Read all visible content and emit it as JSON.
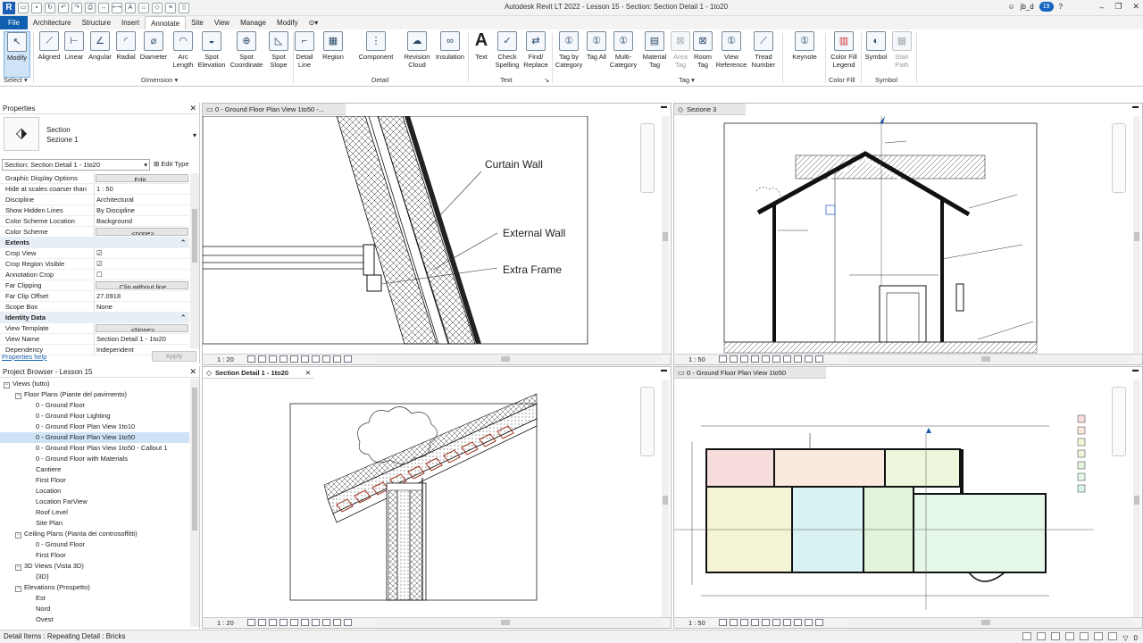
{
  "title_bar": {
    "app_title": "Autodesk Revit LT 2022 - Lesson 15 - Section: Section Detail 1 - 1to20",
    "user": "jb_d",
    "notification_count": "19"
  },
  "tabs": [
    "File",
    "Architecture",
    "Structure",
    "Insert",
    "Annotate",
    "Site",
    "View",
    "Manage",
    "Modify"
  ],
  "active_tab": "Annotate",
  "ribbon": {
    "select": {
      "modify": "Modify",
      "panel": "Select"
    },
    "dimension": {
      "aligned": "Aligned",
      "linear": "Linear",
      "angular": "Angular",
      "radial": "Radial",
      "diameter": "Diameter",
      "arc_length": "Arc Length",
      "spot_elevation": "Spot Elevation",
      "spot_coordinate": "Spot Coordinate",
      "spot_slope": "Spot Slope",
      "panel": "Dimension"
    },
    "detail": {
      "detail_line": "Detail Line",
      "region": "Region",
      "component": "Component",
      "revision_cloud": "Revision Cloud",
      "insulation": "Insulation",
      "panel": "Detail"
    },
    "text": {
      "text": "Text",
      "check_spelling": "Check Spelling",
      "find_replace": "Find/ Replace",
      "panel": "Text"
    },
    "tag": {
      "tag_by_category": "Tag by Category",
      "tag_all": "Tag All",
      "multi_category": "Multi- Category",
      "material_tag": "Material Tag",
      "area_tag": "Area Tag",
      "room_tag": "Room Tag",
      "view_reference": "View Reference",
      "tread_number": "Tread Number",
      "panel": "Tag"
    },
    "keynote": "Keynote",
    "color_fill": {
      "legend": "Color Fill Legend",
      "panel": "Color Fill"
    },
    "symbol": {
      "symbol": "Symbol",
      "stair_path": "Stair Path",
      "panel": "Symbol"
    }
  },
  "properties": {
    "header": "Properties",
    "type_line1": "Section",
    "type_line2": "Sezione 1",
    "instance_selector": "Section: Section Detail 1 - 1to20",
    "edit_type": "Edit Type",
    "rows": [
      {
        "name": "Graphic Display Options",
        "value": "Edit..."
      },
      {
        "name": "Hide at scales coarser than",
        "value": "1 : 50"
      },
      {
        "name": "Discipline",
        "value": "Architectural"
      },
      {
        "name": "Show Hidden Lines",
        "value": "By Discipline"
      },
      {
        "name": "Color Scheme Location",
        "value": "Background"
      },
      {
        "name": "Color Scheme",
        "value": "<none>"
      },
      {
        "name": "Extents",
        "value": ""
      },
      {
        "name": "Crop View",
        "value": "☑"
      },
      {
        "name": "Crop Region Visible",
        "value": "☑"
      },
      {
        "name": "Annotation Crop",
        "value": "☐"
      },
      {
        "name": "Far Clipping",
        "value": "Clip without line"
      },
      {
        "name": "Far Clip Offset",
        "value": "27.0918"
      },
      {
        "name": "Scope Box",
        "value": "None"
      },
      {
        "name": "Identity Data",
        "value": ""
      },
      {
        "name": "View Template",
        "value": "<None>"
      },
      {
        "name": "View Name",
        "value": "Section Detail 1 - 1to20"
      },
      {
        "name": "Dependency",
        "value": "Independent"
      }
    ],
    "help_link": "Properties help",
    "apply": "Apply"
  },
  "browser": {
    "header": "Project Browser - Lesson 15",
    "nodes": [
      "Views (tutto)",
      "Floor Plans (Piante del pavimento)",
      "0 - Ground Floor",
      "0 - Ground Floor Lighting",
      "0 - Ground Floor Plan View 1to10",
      "0 - Ground Floor Plan View 1to50",
      "0 - Ground Floor Plan View 1to50 - Callout 1",
      "0 - Ground Floor with Materials",
      "Cantiere",
      "First Floor",
      "Location",
      "Location FarView",
      "Roof Level",
      "Site Plan",
      "Ceiling Plans (Pianta dei controsoffitti)",
      "0 - Ground Floor",
      "First Floor",
      "3D Views (Vista 3D)",
      "{3D}",
      "Elevations (Prospetto)",
      "Est",
      "Nord",
      "Ovest"
    ]
  },
  "views": {
    "top_left": {
      "title": "0 - Ground Floor Plan View 1to50 -...",
      "scale": "1 : 20",
      "labels": [
        "Curtain Wall",
        "External Wall",
        "Extra Frame"
      ]
    },
    "top_right": {
      "title": "Sezione 3",
      "scale": "1 : 50"
    },
    "bottom_left": {
      "title": "Section Detail 1 - 1to20",
      "scale": "1 : 20"
    },
    "bottom_right": {
      "title": "0 - Ground Floor Plan View 1to50",
      "scale": "1 : 50"
    }
  },
  "status_bar": {
    "text": "Detail Items : Repeating Detail : Bricks",
    "filter_count": "0"
  }
}
